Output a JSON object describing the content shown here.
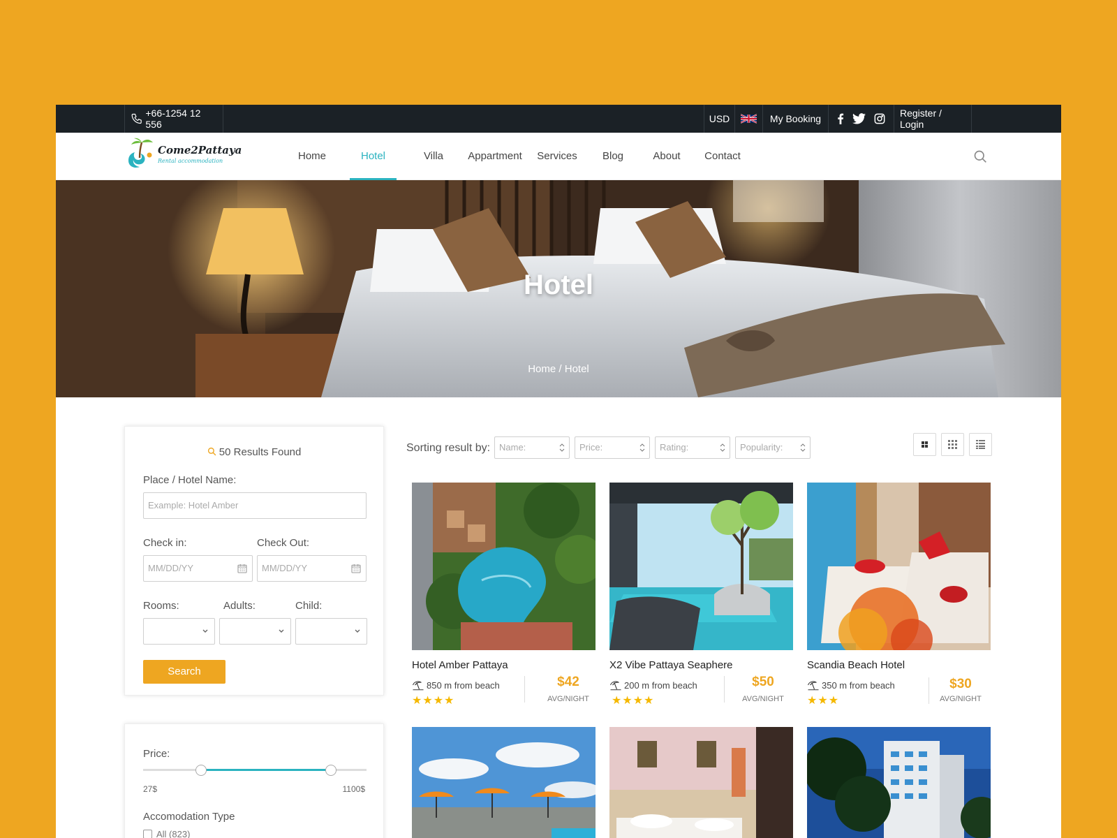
{
  "topbar": {
    "phone": "+66-1254 12 556",
    "currency": "USD",
    "my_booking": "My Booking",
    "register_login": "Register / Login",
    "social": [
      "facebook-icon",
      "twitter-icon",
      "instagram-icon"
    ]
  },
  "brand": {
    "name": "Come2Pattaya",
    "tagline": "Rental accommodation"
  },
  "nav": {
    "items": [
      {
        "label": "Home"
      },
      {
        "label": "Hotel",
        "active": true
      },
      {
        "label": "Villa"
      },
      {
        "label": "Appartment"
      },
      {
        "label": "Services"
      },
      {
        "label": "Blog"
      },
      {
        "label": "About"
      },
      {
        "label": "Contact"
      }
    ]
  },
  "hero": {
    "title": "Hotel",
    "breadcrumb": "Home / Hotel"
  },
  "search": {
    "results": "50 Results Found",
    "place_label": "Place / Hotel Name:",
    "place_placeholder": "Example: Hotel  Amber",
    "checkin_label": "Check in:",
    "checkout_label": "Check Out:",
    "date_placeholder": "MM/DD/YY",
    "rooms_label": "Rooms:",
    "adults_label": "Adults:",
    "child_label": "Child:",
    "button": "Search"
  },
  "filter": {
    "price_label": "Price:",
    "price_min": "27$",
    "price_max": "1100$",
    "range_low": 0.26,
    "range_high": 0.84,
    "type_label": "Accomodation Type",
    "type_all": "All (823)"
  },
  "sort": {
    "label": "Sorting result by:",
    "options": [
      "Name:",
      "Price:",
      "Rating:",
      "Popularity:"
    ]
  },
  "hotels": [
    {
      "name": "Hotel Amber Pattaya",
      "distance": "850 m from beach",
      "price": "$42",
      "per": "AVG/NIGHT",
      "stars": "★★★★"
    },
    {
      "name": "X2 Vibe Pattaya Seaphere",
      "distance": "200 m from beach",
      "price": "$50",
      "per": "AVG/NIGHT",
      "stars": "★★★★"
    },
    {
      "name": "Scandia Beach Hotel",
      "distance": "350 m from beach",
      "price": "$30",
      "per": "AVG/NIGHT",
      "stars": "★★★"
    }
  ],
  "colors": {
    "accent": "#EEA621",
    "teal": "#2bb3c0",
    "topbar": "#1b2126"
  }
}
